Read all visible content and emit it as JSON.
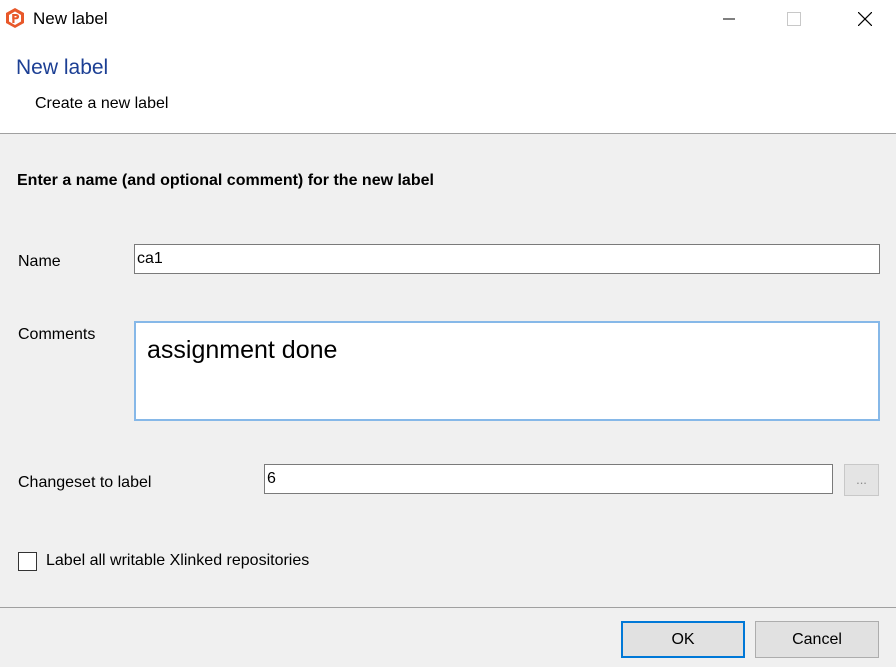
{
  "window": {
    "title": "New label",
    "app_icon": "plastic-scm-logo-icon",
    "controls": [
      "minimize-icon",
      "maximize-icon",
      "close-icon"
    ]
  },
  "header": {
    "title": "New label",
    "subtitle": "Create a new label"
  },
  "form": {
    "instruction": "Enter a name (and optional comment) for the new label",
    "name_label": "Name",
    "name_value": "ca1",
    "comments_label": "Comments",
    "comments_value": "assignment done",
    "changeset_label": "Changeset to label",
    "changeset_value": "6",
    "browse_label": "...",
    "xlinked_label": "Label all writable Xlinked repositories",
    "xlinked_checked": false
  },
  "buttons": {
    "ok": "OK",
    "cancel": "Cancel"
  },
  "colors": {
    "header_title": "#1c3f94",
    "focus_border": "#0078d7",
    "logo": "#e8582a"
  }
}
